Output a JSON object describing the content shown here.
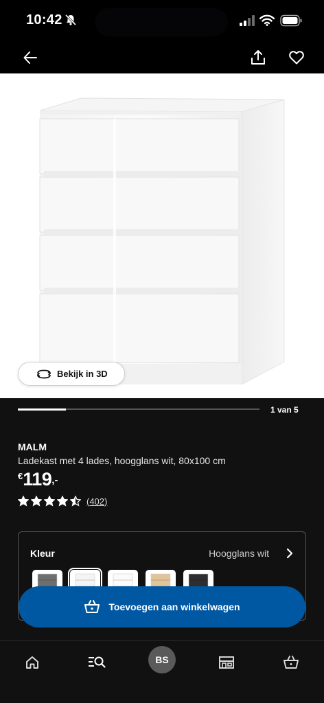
{
  "status_bar": {
    "time": "10:42",
    "icons": [
      "bell-slash-icon",
      "cellular-signal-icon",
      "wifi-icon",
      "battery-icon"
    ]
  },
  "app_bar": {
    "icons": [
      "back-arrow-icon",
      "share-icon",
      "heart-icon"
    ]
  },
  "gallery": {
    "view_3d_label": "Bekijk in 3D",
    "pager_text": "1 van 5",
    "progress": 0.2
  },
  "product": {
    "name": "MALM",
    "description": "Ladekast met 4 lades, hoogglans wit, 80x100 cm",
    "price_currency": "€",
    "price_integer": "119",
    "price_decimal": ",-",
    "rating_stars": 4.5,
    "rating_count": "(402)"
  },
  "color_selector": {
    "label": "Kleur",
    "selected_value": "Hoogglans wit",
    "swatches": [
      {
        "name": "grey",
        "color": "#6f6f6f"
      },
      {
        "name": "white-high-gloss",
        "color": "#f4f4f4",
        "selected": true
      },
      {
        "name": "white",
        "color": "#fbfbfb"
      },
      {
        "name": "oak",
        "color": "#e2c49a"
      },
      {
        "name": "black-brown",
        "color": "#2e2e30"
      }
    ]
  },
  "cart_button": {
    "label": "Toevoegen aan winkelwagen",
    "color": "#0058a3"
  },
  "bottom_nav": {
    "items": [
      "home-icon",
      "search-icon",
      "profile-avatar",
      "store-icon",
      "cart-icon"
    ],
    "avatar_initials": "BS"
  }
}
